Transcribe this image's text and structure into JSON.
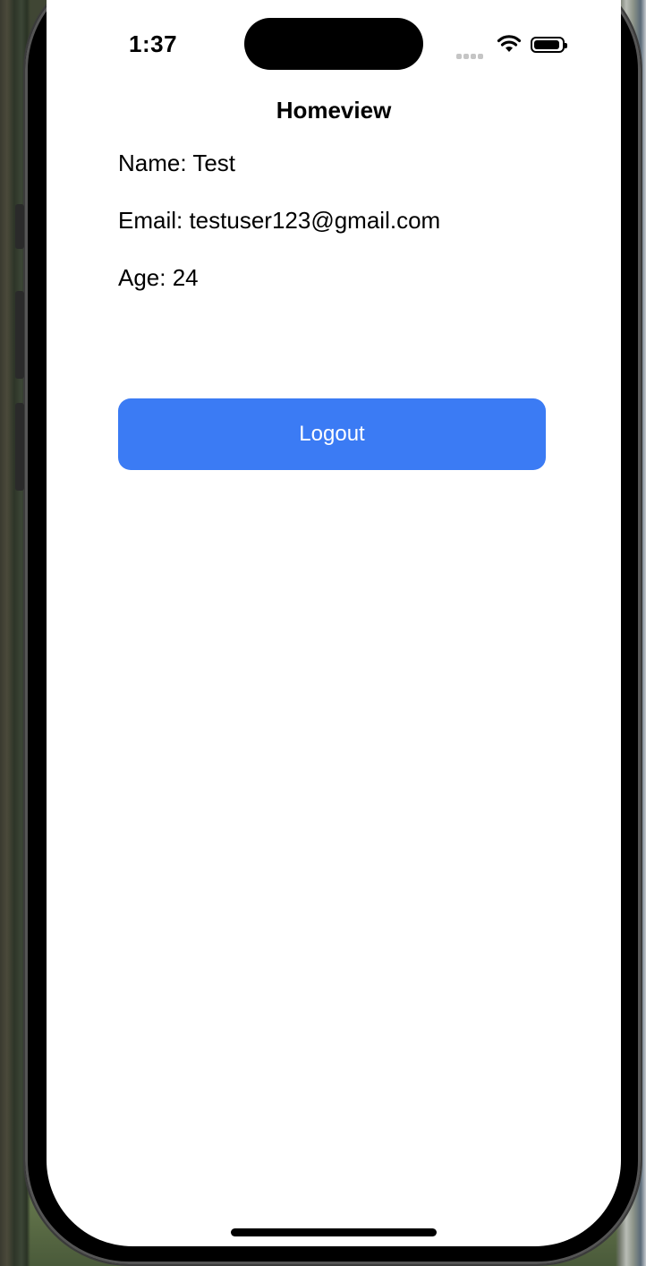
{
  "status_bar": {
    "time": "1:37",
    "icons": [
      "cellular-icon",
      "wifi-icon",
      "battery-icon"
    ]
  },
  "nav": {
    "title": "Homeview"
  },
  "profile": {
    "name_line": "Name: Test",
    "email_line": "Email: testuser123@gmail.com",
    "age_line": "Age: 24"
  },
  "actions": {
    "logout_label": "Logout"
  },
  "colors": {
    "accent": "#3b7bf4",
    "background": "#ffffff",
    "text": "#000000"
  }
}
